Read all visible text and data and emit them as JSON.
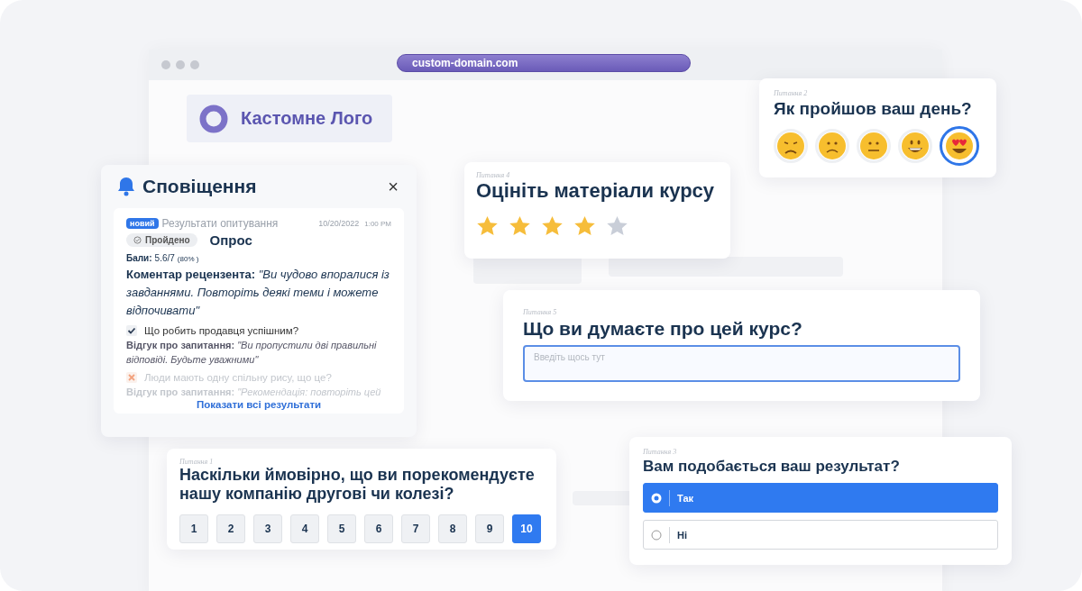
{
  "browser": {
    "url": "custom-domain.com"
  },
  "logo": {
    "text": "Кастомне Лого"
  },
  "notifications": {
    "title": "Сповіщення",
    "close": "×",
    "entry": {
      "badge": "новий",
      "source": "Результати опитування",
      "date": "10/20/2022",
      "time": "1:00 PM",
      "status": "Пройдено",
      "name": "Опрос",
      "score_label": "Бали:",
      "score": "5.6/7",
      "percent": "(80% )",
      "comment": "**Коментар рецензента:** *\"Ви чудово впоралися із завданнями. Повторіть деякі теми і можете відпочивати\"*",
      "items": [
        {
          "kind": "correct",
          "question": "Що робить продавця успішним?",
          "feedback": "**Відгук про запитання:** *\"Ви пропустили дві правильні відповіді. Будьте уважними\"*"
        },
        {
          "kind": "incorrect",
          "question": "Люди мають одну спільну рису, що це?",
          "feedback": "**Відгук про запитання:** *\"Рекомендація: повторіть цей*"
        }
      ]
    },
    "link": "Показати всі результати"
  },
  "question_2": {
    "number": "Питання 2",
    "title": "Як пройшов ваш день?",
    "faces": [
      {
        "kind": "sad",
        "selected": false
      },
      {
        "kind": "frown",
        "selected": false
      },
      {
        "kind": "neutral",
        "selected": false
      },
      {
        "kind": "smile",
        "selected": false
      },
      {
        "kind": "love",
        "selected": true
      }
    ]
  },
  "question_4": {
    "number": "Питання 4",
    "title": "Оцініть матеріали курсу",
    "stars": 4
  },
  "question_5": {
    "number": "Питання 5",
    "title": "Що ви думаєте про цей курс?",
    "placeholder": "Введіть щось тут"
  },
  "question_1": {
    "number": "Питання 1",
    "title": "Наскільки ймовірно, що ви порекомендуєте нашу компанію другові чи колезі?",
    "options": [
      {
        "label": "1",
        "selected": false
      },
      {
        "label": "2",
        "selected": false
      },
      {
        "label": "3",
        "selected": false
      },
      {
        "label": "4",
        "selected": false
      },
      {
        "label": "5",
        "selected": false
      },
      {
        "label": "6",
        "selected": false
      },
      {
        "label": "7",
        "selected": false
      },
      {
        "label": "8",
        "selected": false
      },
      {
        "label": "9",
        "selected": false
      },
      {
        "label": "10",
        "selected": true
      }
    ]
  },
  "question_3": {
    "number": "Питання 3",
    "title": "Вам подобається ваш результат?",
    "options": [
      {
        "label": "Так",
        "selected": true
      },
      {
        "label": "Ні",
        "selected": false
      }
    ]
  }
}
